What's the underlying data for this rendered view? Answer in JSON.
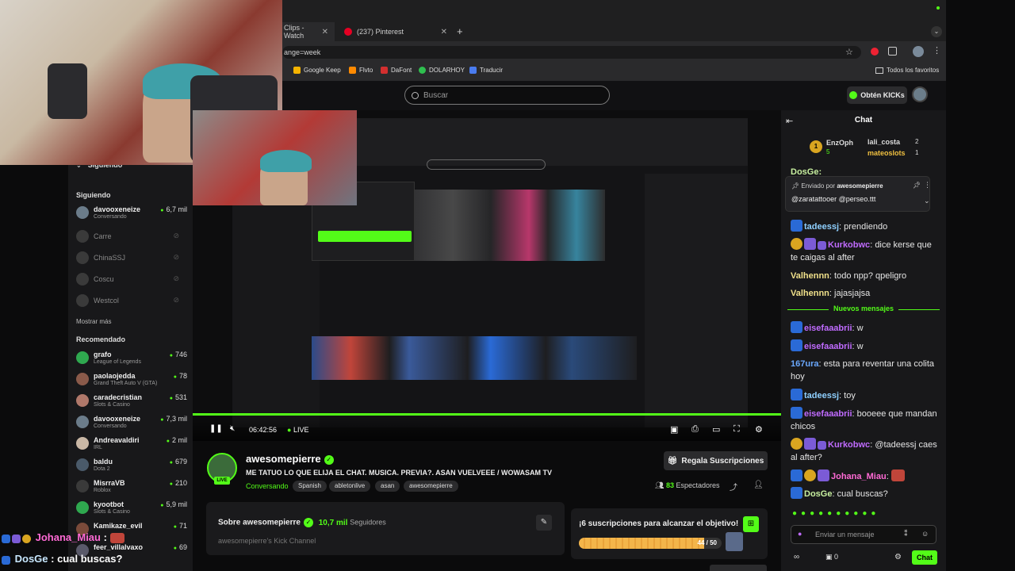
{
  "tabs": [
    {
      "label": "Clips - Watch"
    },
    {
      "label": "(237) Pinterest"
    }
  ],
  "address": {
    "url": "ange=week"
  },
  "bookmarks": [
    {
      "label": "Google Keep",
      "color": "#f6b400"
    },
    {
      "label": "Flvto",
      "color": "#ff8a00"
    },
    {
      "label": "DaFont",
      "color": "#d32f2f"
    },
    {
      "label": "DOLARHOY",
      "color": "#2fbf4f"
    },
    {
      "label": "Traducir",
      "color": "#4a7cf0"
    }
  ],
  "bookmarks_right": "Todos los favoritos",
  "header": {
    "search_placeholder": "Buscar",
    "kicks_label": "Obtén KICKs"
  },
  "sidebar": {
    "top_label": "Siguiendo",
    "following_title": "Siguiendo",
    "following": [
      {
        "name": "davooxeneize",
        "sub": "Conversando",
        "viewers": "6,7 mil",
        "online": true
      },
      {
        "name": "Carre",
        "online": false
      },
      {
        "name": "ChinaSSJ",
        "online": false
      },
      {
        "name": "Coscu",
        "online": false
      },
      {
        "name": "Westcol",
        "online": false
      }
    ],
    "show_more": "Mostrar más",
    "recommended_title": "Recomendado",
    "recommended": [
      {
        "name": "grafo",
        "sub": "League of Legends",
        "viewers": "746"
      },
      {
        "name": "paolaojedda",
        "sub": "Grand Theft Auto V (GTA)",
        "viewers": "78"
      },
      {
        "name": "caradecristian",
        "sub": "Slots & Casino",
        "viewers": "531"
      },
      {
        "name": "davooxeneize",
        "sub": "Conversando",
        "viewers": "7,3 mil"
      },
      {
        "name": "Andreavaldiri",
        "sub": "IRL",
        "viewers": "2 mil"
      },
      {
        "name": "baldu",
        "sub": "Dota 2",
        "viewers": "679"
      },
      {
        "name": "MisrraVB",
        "sub": "Roblox",
        "viewers": "210"
      },
      {
        "name": "kyootbot",
        "sub": "Slots & Casino",
        "viewers": "5,9 mil"
      },
      {
        "name": "Kamikaze_evil",
        "sub": "",
        "viewers": "71"
      },
      {
        "name": "feer_villalvaxo",
        "sub": "",
        "viewers": "69"
      }
    ]
  },
  "player": {
    "time": "06:42:56",
    "live": "LIVE"
  },
  "channel": {
    "name": "awesomepierre",
    "live_tag": "LIVE",
    "title": "ME TATUO LO QUE ELIJA EL CHAT. MUSICA. PREVIA?. ASAN VUELVEEE / WOWASAM TV",
    "category": "Conversando",
    "tags": [
      "Spanish",
      "abletonlive",
      "asan",
      "awesomepierre"
    ],
    "subs_button": "Regala Suscripciones",
    "viewers_count": "83",
    "viewers_label": "Espectadores",
    "about_title": "Sobre awesomepierre",
    "followers_count": "10,7 mil",
    "followers_label": "Seguidores",
    "about_desc": "awesomepierre's Kick Channel",
    "goal_text": "¡6 suscripciones para alcanzar el objetivo!",
    "goal_progress": "44 / 50",
    "goal_fraction": 0.88
  },
  "chat": {
    "title": "Chat",
    "top_gifters": [
      {
        "name": "EnzOph",
        "count": "5"
      },
      {
        "name": "lali_costa",
        "count": "2"
      },
      {
        "name": "mateoslots",
        "count": "1"
      }
    ],
    "pinned_by_label": "Enviado por",
    "pinned_by": "awesomepierre",
    "pinned_text": "@zaratattooer @perseo.ttt",
    "partial_top": "DosGe:",
    "messages": [
      {
        "user": "tadeessj",
        "color": "#8fd0ff",
        "text": "prendiendo"
      },
      {
        "user": "Kurkobwc",
        "color": "#c06bff",
        "text": "dice kerse que te caigas al after"
      },
      {
        "user": "Valhennn",
        "color": "#f0e08a",
        "text": "todo npp? qpeligro"
      },
      {
        "user": "Valhennn",
        "color": "#f0e08a",
        "text": "jajasjajsa"
      }
    ],
    "new_messages": "Nuevos mensajes",
    "messages2": [
      {
        "user": "eisefaaabrii",
        "color": "#c06bff",
        "text": "w"
      },
      {
        "user": "eisefaaabrii",
        "color": "#c06bff",
        "text": "w"
      },
      {
        "user": "167ura",
        "color": "#6aa8ff",
        "text": "esta para reventar una colita hoy"
      },
      {
        "user": "tadeessj",
        "color": "#8fd0ff",
        "text": "toy"
      },
      {
        "user": "eisefaaabrii",
        "color": "#c06bff",
        "text": "booeee que mandan chicos"
      },
      {
        "user": "Kurkobwc",
        "color": "#c06bff",
        "text": "@tadeessj caes al after?"
      },
      {
        "user": "Johana_Miau",
        "color": "#ff6ad5",
        "text": ""
      },
      {
        "user": "DosGe",
        "color": "#c8f0a0",
        "text": "cual buscas?"
      }
    ],
    "input_placeholder": "Enviar un mensaje",
    "kicks_balance": "0",
    "send_label": "Chat"
  },
  "overlay": {
    "line1_user": "Johana_Miau",
    "line2_user": "DosGe",
    "line2_text": "cual buscas?"
  }
}
